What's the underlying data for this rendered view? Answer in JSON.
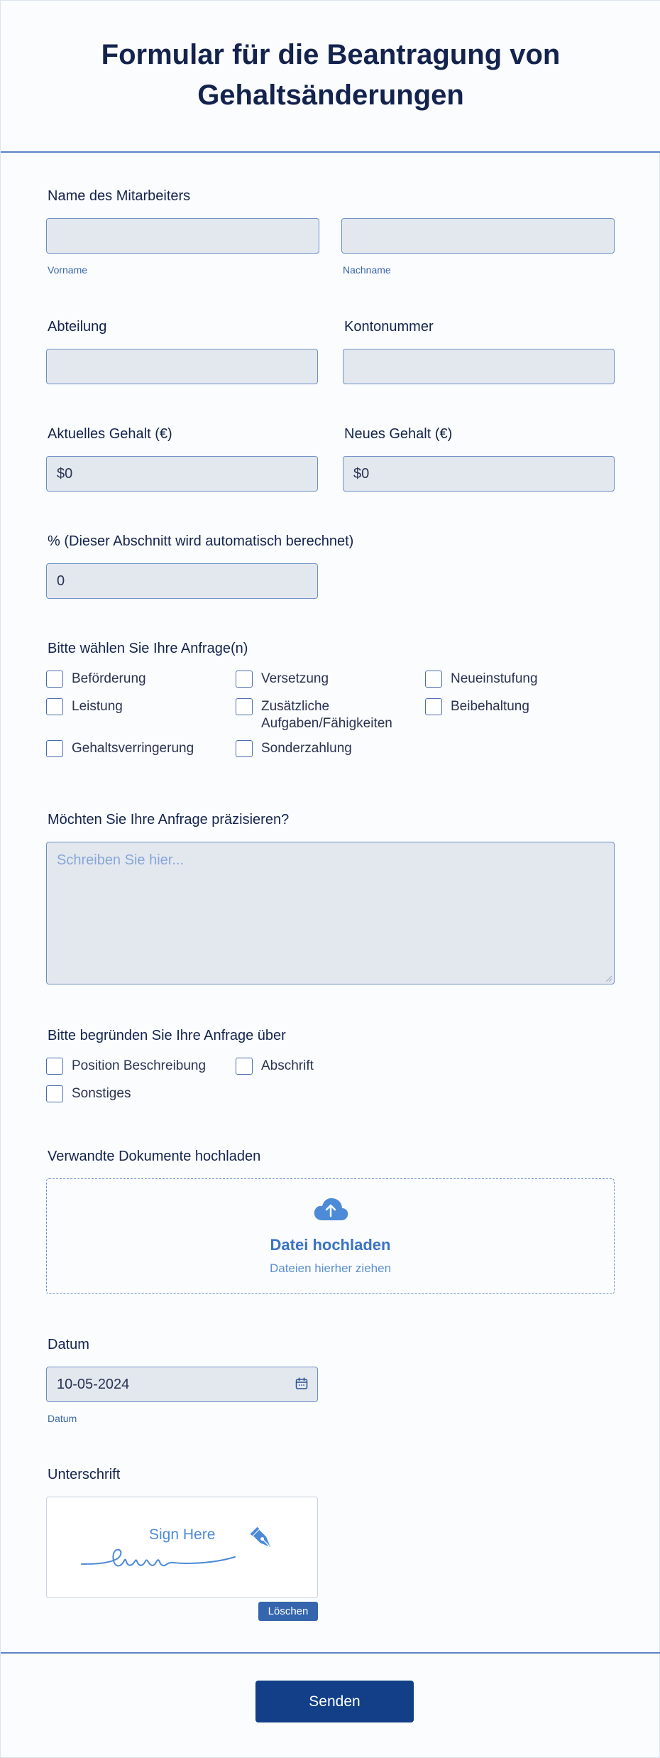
{
  "header": {
    "title": "Formular für die Beantragung von Gehaltsänderungen"
  },
  "employee_name": {
    "label": "Name des Mitarbeiters",
    "first_sublabel": "Vorname",
    "last_sublabel": "Nachname",
    "first_value": "",
    "last_value": ""
  },
  "department": {
    "label": "Abteilung",
    "value": ""
  },
  "account": {
    "label": "Kontonummer",
    "value": ""
  },
  "current_salary": {
    "label": "Aktuelles Gehalt (€)",
    "value": "$0"
  },
  "new_salary": {
    "label": "Neues Gehalt (€)",
    "value": "$0"
  },
  "percent": {
    "label": "% (Dieser Abschnitt wird automatisch berechnet)",
    "value": "0"
  },
  "requests": {
    "label": "Bitte wählen Sie Ihre Anfrage(n)",
    "options": [
      "Beförderung",
      "Versetzung",
      "Neueinstufung",
      "Leistung",
      "Zusätzliche Aufgaben/Fähigkeiten",
      "Beibehaltung",
      "Gehaltsverringerung",
      "Sonderzahlung"
    ]
  },
  "details": {
    "label": "Möchten Sie Ihre Anfrage präzisieren?",
    "placeholder": "Schreiben Sie hier..."
  },
  "justify": {
    "label": "Bitte begründen Sie Ihre Anfrage über",
    "options": [
      "Position Beschreibung",
      "Abschrift",
      "Sonstiges"
    ]
  },
  "upload": {
    "label": "Verwandte Dokumente hochladen",
    "title": "Datei hochladen",
    "subtitle": "Dateien hierher ziehen",
    "icon": "cloud-upload-icon"
  },
  "date": {
    "label": "Datum",
    "value": "10-05-2024",
    "sublabel": "Datum",
    "icon": "calendar-icon"
  },
  "signature": {
    "label": "Unterschrift",
    "placeholder": "Sign Here",
    "clear_label": "Löschen",
    "icon": "pen-nib-icon"
  },
  "submit": {
    "label": "Senden"
  },
  "colors": {
    "accent": "#123f87",
    "border": "#6e8fc6",
    "field_bg": "#e3e8ef",
    "link": "#3a73c4"
  }
}
